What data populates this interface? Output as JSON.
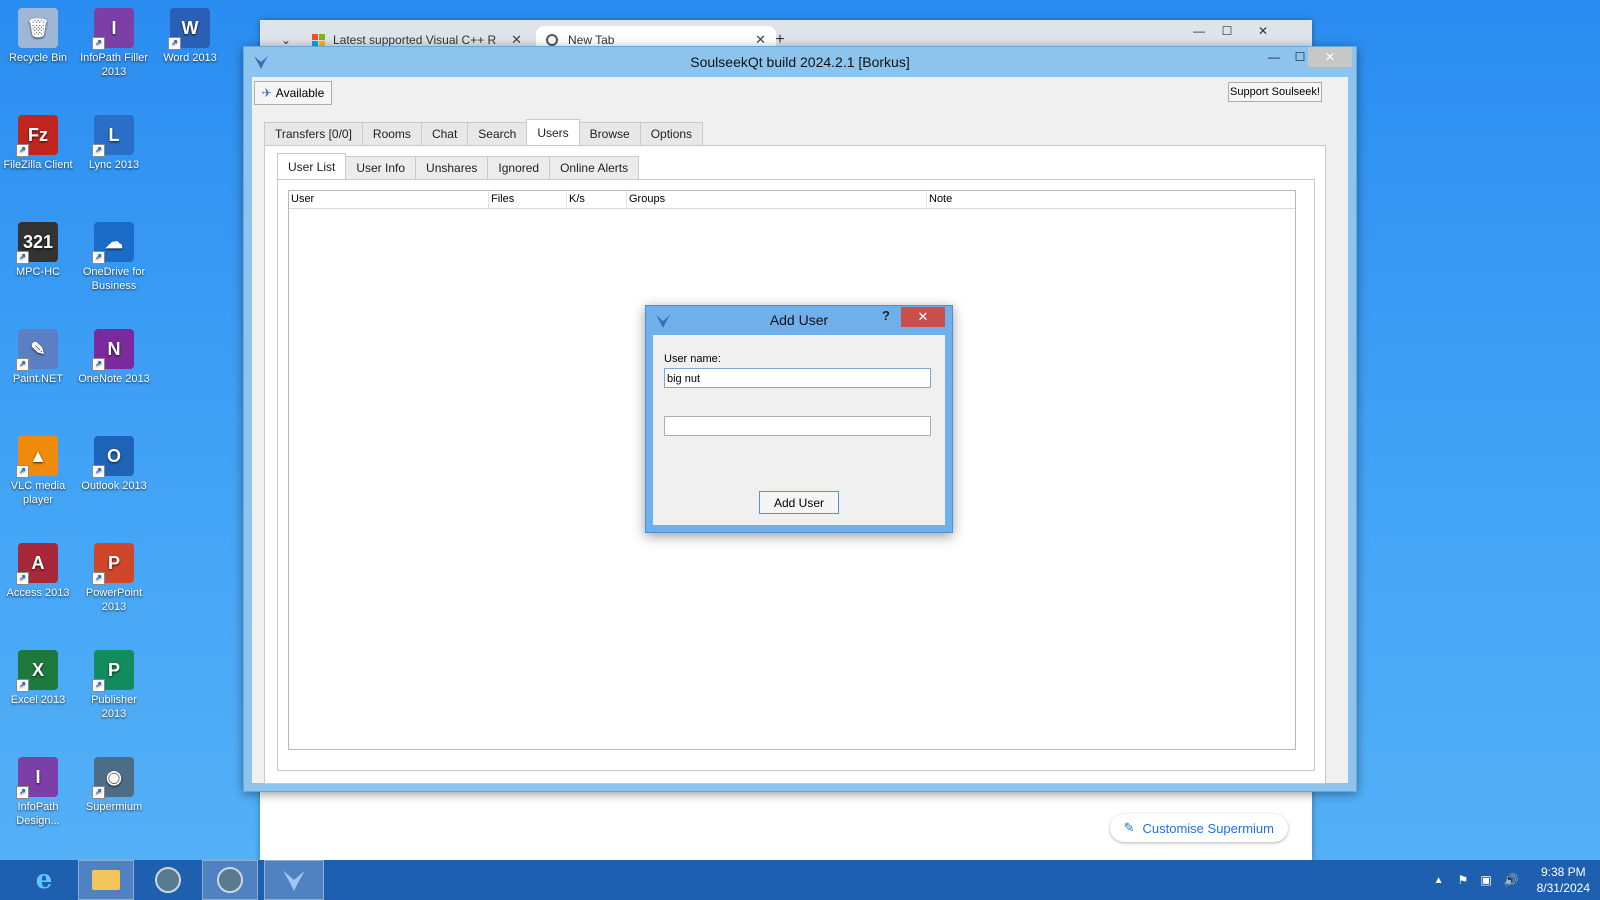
{
  "desktop": {
    "icons": [
      {
        "label": "Recycle Bin",
        "name": "recycle-bin-icon",
        "color": "#9fb7d4",
        "glyph": "🗑"
      },
      {
        "label": "InfoPath Filler 2013",
        "name": "infopath-filler-icon",
        "color": "#7b3fa7",
        "glyph": "I"
      },
      {
        "label": "Word 2013",
        "name": "word-icon",
        "color": "#2b5fb3",
        "glyph": "W"
      },
      {
        "label": "FileZilla Client",
        "name": "filezilla-icon",
        "color": "#c0261f",
        "glyph": "Fz"
      },
      {
        "label": "Lync 2013",
        "name": "lync-icon",
        "color": "#2a6ec8",
        "glyph": "L"
      },
      {
        "label": "MPC-HC",
        "name": "mpc-hc-icon",
        "color": "#333333",
        "glyph": "321"
      },
      {
        "label": "OneDrive for Business",
        "name": "onedrive-icon",
        "color": "#1b6cc8",
        "glyph": "☁"
      },
      {
        "label": "Paint.NET",
        "name": "paintnet-icon",
        "color": "#5b7fc5",
        "glyph": "✎"
      },
      {
        "label": "OneNote 2013",
        "name": "onenote-icon",
        "color": "#7a2a9c",
        "glyph": "N"
      },
      {
        "label": "VLC media player",
        "name": "vlc-icon",
        "color": "#f08a0c",
        "glyph": "▲"
      },
      {
        "label": "Outlook 2013",
        "name": "outlook-icon",
        "color": "#1f63b8",
        "glyph": "O"
      },
      {
        "label": "Access 2013",
        "name": "access-icon",
        "color": "#a6283a",
        "glyph": "A"
      },
      {
        "label": "PowerPoint 2013",
        "name": "powerpoint-icon",
        "color": "#d0462a",
        "glyph": "P"
      },
      {
        "label": "Excel 2013",
        "name": "excel-icon",
        "color": "#1e7a3c",
        "glyph": "X"
      },
      {
        "label": "Publisher 2013",
        "name": "publisher-icon",
        "color": "#128c5e",
        "glyph": "P"
      },
      {
        "label": "InfoPath Design...",
        "name": "infopath-designer-icon",
        "color": "#7b3fa7",
        "glyph": "I"
      },
      {
        "label": "Supermium",
        "name": "supermium-icon",
        "color": "#4d6d86",
        "glyph": "◉"
      }
    ]
  },
  "browser": {
    "tabs": [
      {
        "label": "Latest supported Visual C++ R"
      },
      {
        "label": "New Tab"
      }
    ],
    "customise_label": "Customise Supermium"
  },
  "soulseek": {
    "title": "SoulseekQt build 2024.2.1 [Borkus]",
    "status_button": "Available",
    "support_button": "Support Soulseek!",
    "main_tabs": [
      "Transfers [0/0]",
      "Rooms",
      "Chat",
      "Search",
      "Users",
      "Browse",
      "Options"
    ],
    "active_main_tab": "Users",
    "sub_tabs": [
      "User List",
      "User Info",
      "Unshares",
      "Ignored",
      "Online Alerts"
    ],
    "columns": [
      "User",
      "Files",
      "K/s",
      "Groups",
      "Note"
    ]
  },
  "dialog": {
    "title": "Add User",
    "help": "?",
    "username_label": "User name:",
    "username_value": "big nut",
    "second_value": "",
    "button": "Add User"
  },
  "taskbar": {
    "time": "9:38 PM",
    "date": "8/31/2024"
  }
}
